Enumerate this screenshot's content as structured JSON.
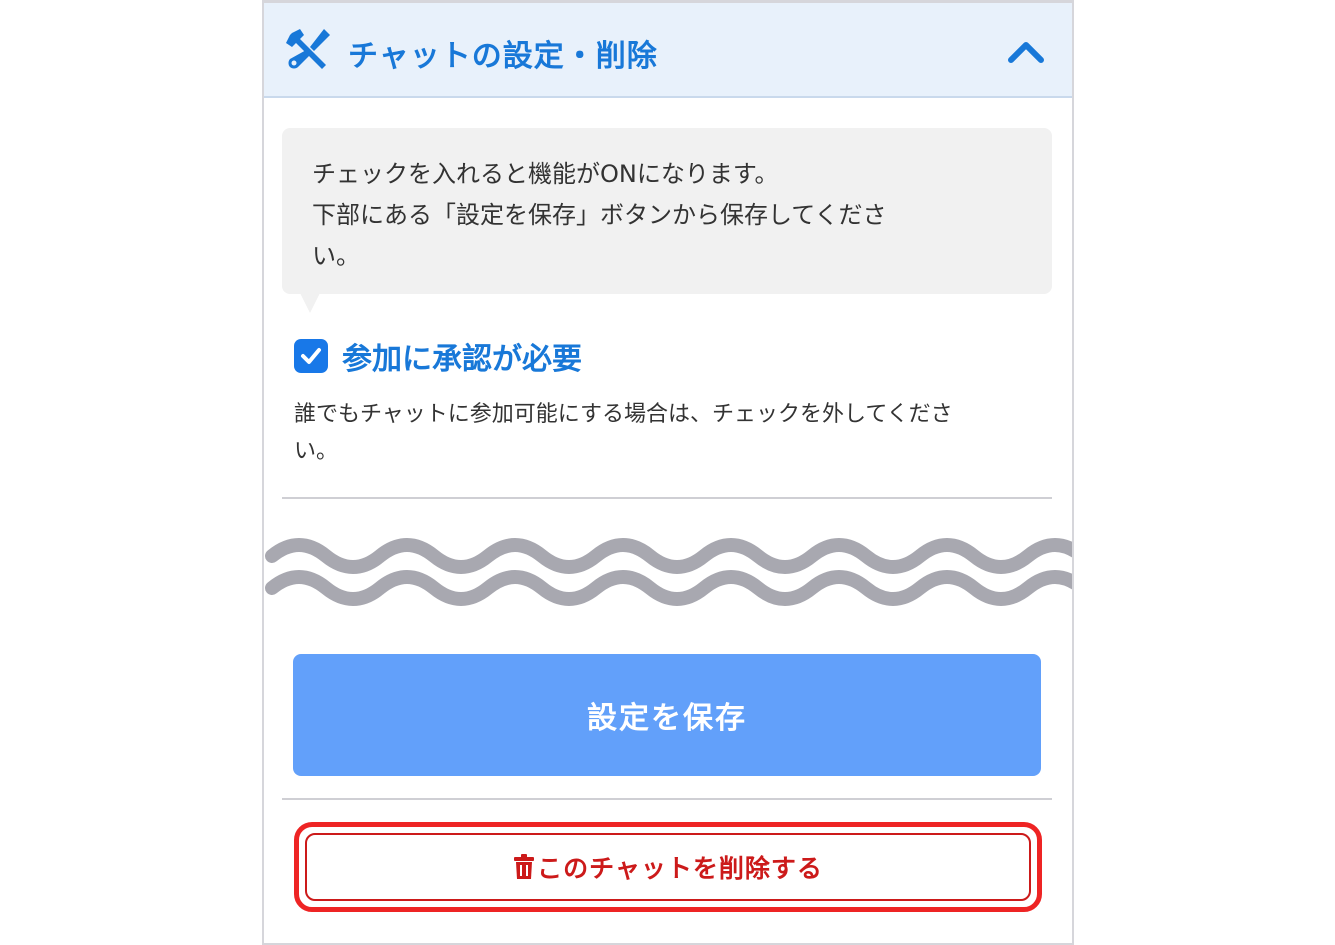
{
  "header": {
    "title": "チャットの設定・削除",
    "tools_icon": "tools-icon",
    "collapse_icon": "chevron-up-icon"
  },
  "info_bubble": {
    "lines": [
      "チェックを入れると機能がONになります。",
      "下部にある「設定を保存」ボタンから保存してくださ",
      "い。"
    ]
  },
  "approval_setting": {
    "checked": true,
    "label": "参加に承認が必要",
    "description_lines": [
      "誰でもチャットに参加可能にする場合は、チェックを外してくださ",
      "い。"
    ]
  },
  "save_button": {
    "label": "設定を保存"
  },
  "delete_button": {
    "icon": "trash-icon",
    "label": "このチャットを削除する"
  },
  "colors": {
    "accent": "#1878d8",
    "header_bg": "#e8f1fb",
    "save_bg": "#62a0fa",
    "danger": "#ee2424",
    "wave": "#a8a8b0"
  }
}
